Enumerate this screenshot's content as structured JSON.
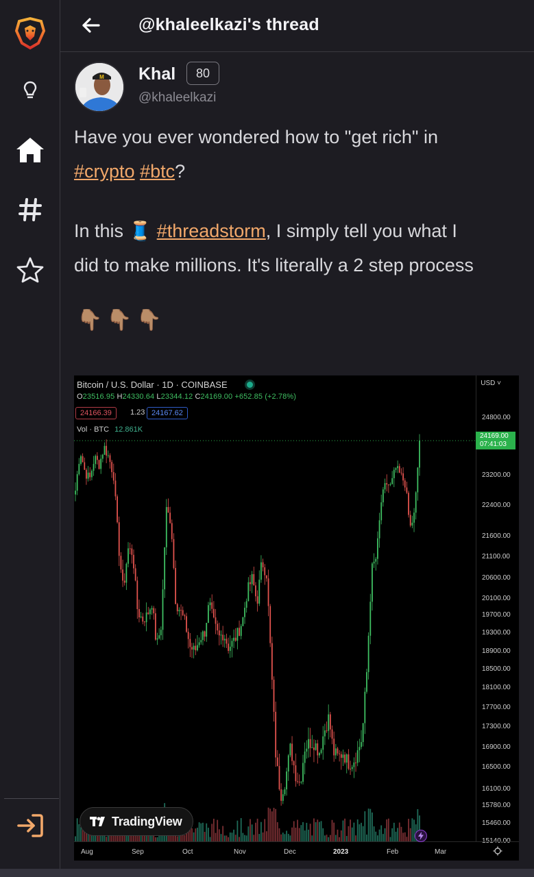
{
  "header": {
    "title": "@khaleelkazi's thread"
  },
  "author": {
    "name": "Khal",
    "score": "80",
    "handle": "@khaleelkazi"
  },
  "post": {
    "line1": "Have you ever wondered how to \"get rich\" in",
    "tag_crypto": "#crypto",
    "tag_btc": "#btc",
    "line2_end": "?",
    "line3_start": "In this ",
    "spool_emoji": "🧵",
    "tag_threadstorm": "#threadstorm",
    "line3_end": ", I simply tell you what I",
    "line4": "did to make millions. It's literally a 2 step process",
    "emojis": [
      "👇🏽",
      "👇🏽",
      "👇🏽"
    ]
  },
  "sidebar": {
    "icons": [
      "lion-logo-icon",
      "lightbulb-icon",
      "home-icon",
      "hashtag-icon",
      "star-icon",
      "login-icon"
    ]
  },
  "colors": {
    "accent": "#f2a86a",
    "up": "#3fbf62",
    "down": "#e2534e",
    "background": "#1d1c22"
  },
  "chart": {
    "title": "Bitcoin / U.S. Dollar · 1D · COINBASE",
    "ohlc": {
      "o_label": "O",
      "o": "23516.95",
      "h_label": "H",
      "h": "24330.64",
      "l_label": "L",
      "l": "23344.12",
      "c_label": "C",
      "c": "24169.00",
      "change": "+652.85 (+2.78%)"
    },
    "sell_price": "24166.39",
    "spread": "1.23",
    "buy_price": "24167.62",
    "volume_label": "Vol · BTC",
    "volume_value": "12.861K",
    "currency": "USD",
    "last_price": "24169.00",
    "countdown": "07:41:03",
    "logo_text": "TradingView"
  },
  "chart_data": {
    "type": "candlestick",
    "title": "Bitcoin / U.S. Dollar · 1D · COINBASE",
    "y_ticks": [
      "24800.00",
      "23200.00",
      "22400.00",
      "21600.00",
      "21100.00",
      "20600.00",
      "20100.00",
      "19700.00",
      "19300.00",
      "18900.00",
      "18500.00",
      "18100.00",
      "17700.00",
      "17300.00",
      "16900.00",
      "16500.00",
      "16100.00",
      "15780.00",
      "15460.00",
      "15140.00"
    ],
    "x_ticks": [
      "Aug",
      "Sep",
      "Oct",
      "Nov",
      "Dec",
      "2023",
      "Feb",
      "Mar"
    ],
    "close_path": [
      22800,
      23900,
      23300,
      23100,
      23700,
      23500,
      24000,
      23700,
      23200,
      21400,
      20300,
      21300,
      21200,
      19800,
      19600,
      19700,
      20000,
      19000,
      19500,
      22300,
      22000,
      20000,
      19800,
      19500,
      19000,
      18900,
      19200,
      19300,
      20000,
      19500,
      19200,
      19300,
      19000,
      19100,
      19300,
      19600,
      20300,
      20600,
      20000,
      21000,
      20700,
      18500,
      16600,
      16000,
      16300,
      16900,
      16400,
      16200,
      16900,
      17000,
      17000,
      16800,
      17200,
      17500,
      16800,
      16700,
      16800,
      16600,
      16600,
      16800,
      17100,
      18500,
      20800,
      21100,
      22500,
      23000,
      22900,
      23400,
      23200,
      23000,
      21800,
      22200,
      24169
    ]
  }
}
